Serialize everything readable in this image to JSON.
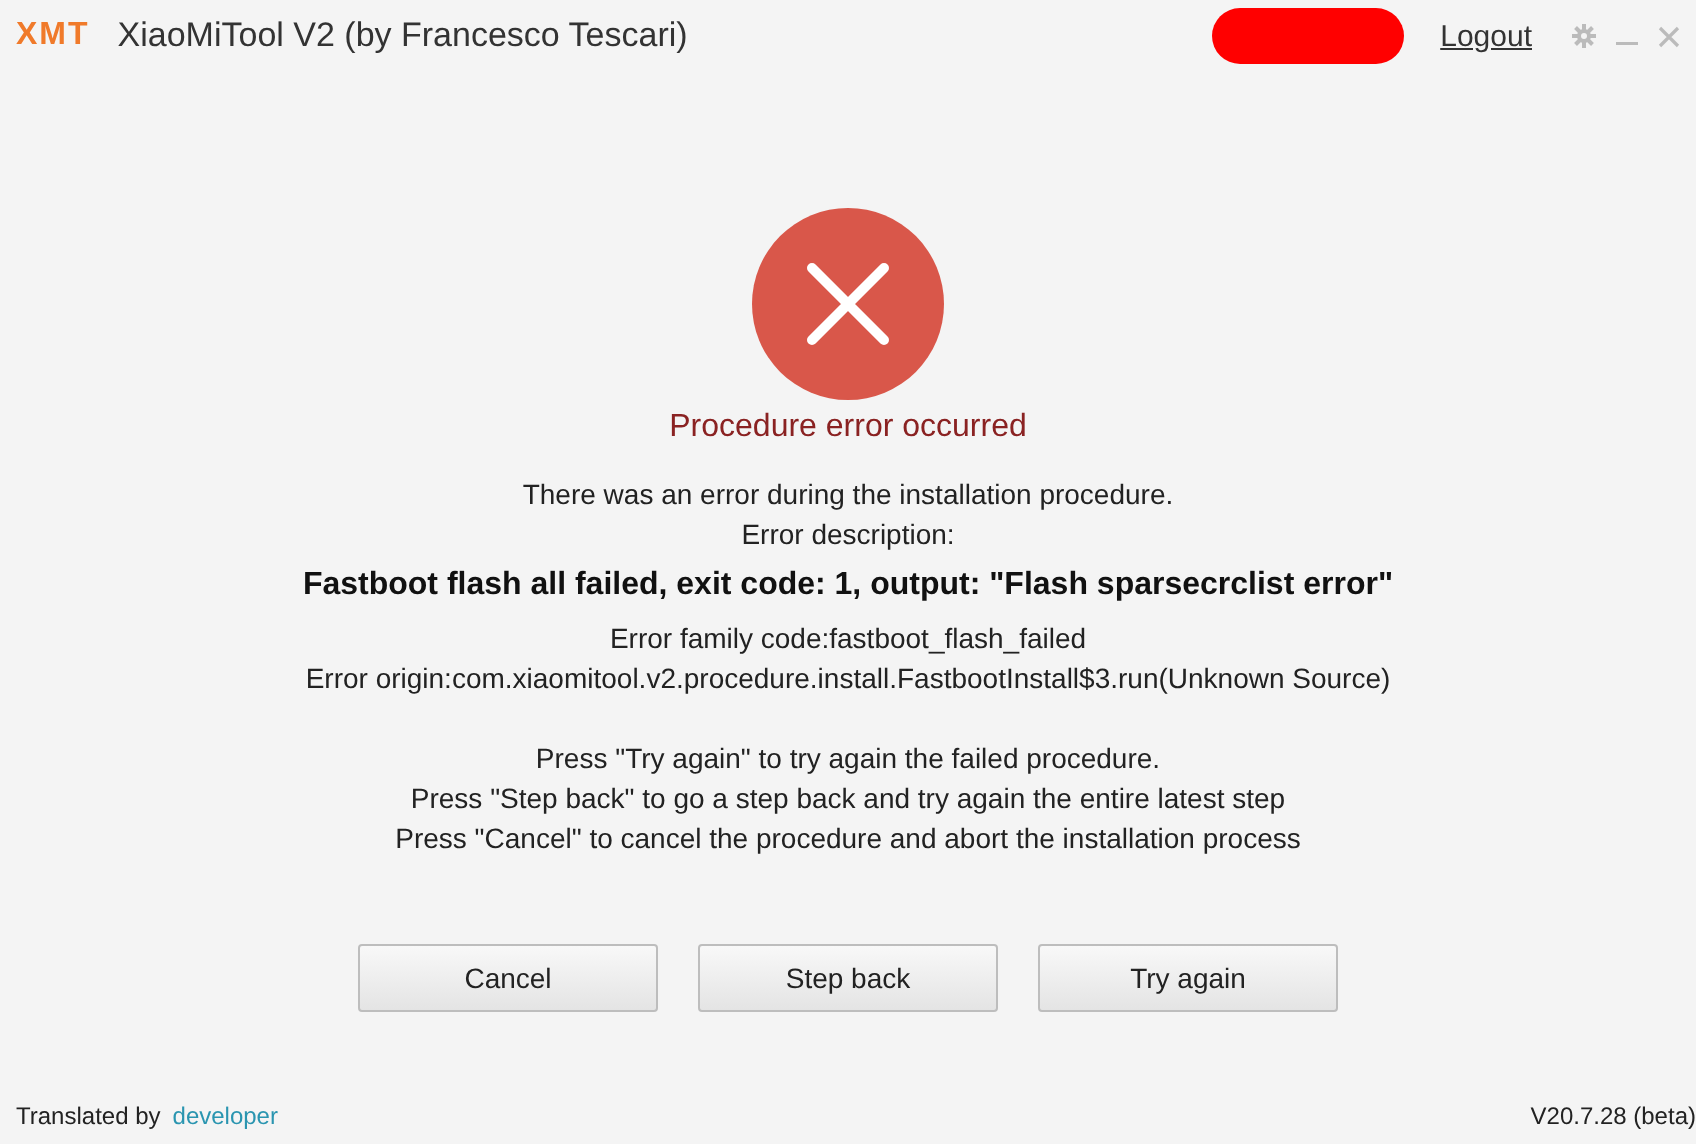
{
  "window": {
    "logo": "XMT",
    "title": "XiaoMiTool V2 (by Francesco Tescari)",
    "logout": "Logout"
  },
  "error": {
    "title": "Procedure error occurred",
    "intro": [
      "There was an error during the installation procedure.",
      "Error description:"
    ],
    "message": "Fastboot flash all failed, exit code: 1, output: \"Flash sparsecrclist error\"",
    "details": [
      "Error family code:fastboot_flash_failed",
      "Error origin:com.xiaomitool.v2.procedure.install.FastbootInstall$3.run(Unknown Source)"
    ],
    "instructions": [
      "Press \"Try again\" to try again the failed procedure.",
      "Press \"Step back\" to go a step back and try again the entire latest step",
      "Press \"Cancel\" to cancel the procedure and abort the installation process"
    ]
  },
  "buttons": [
    "Cancel",
    "Step back",
    "Try again"
  ],
  "footer": {
    "translated_by": "Translated by",
    "translator": "developer",
    "version": "V20.7.28 (beta)"
  }
}
